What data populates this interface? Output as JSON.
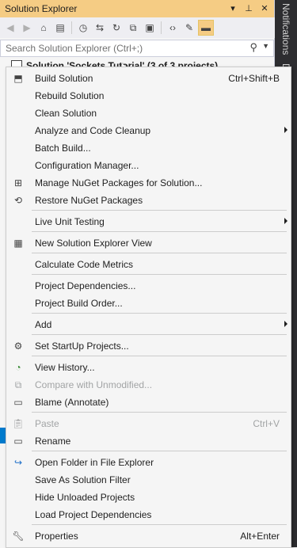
{
  "window": {
    "title": "Solution Explorer",
    "title_icons": [
      "chevron-down-icon",
      "pin-icon",
      "close-icon"
    ]
  },
  "toolbar": {
    "buttons": [
      "back-icon",
      "forward-icon",
      "home-icon",
      "switch-views-icon",
      "pending-changes-icon",
      "sync-icon",
      "refresh-icon",
      "collapse-all-icon",
      "show-all-files-icon",
      "view-code-icon",
      "properties-icon",
      "preview-icon"
    ]
  },
  "search": {
    "placeholder": "Search Solution Explorer (Ctrl+;)"
  },
  "tree": {
    "solution_label": "Solution 'Sockets Tutorial' (3 of 3 projects)"
  },
  "side_tabs": {
    "notifications": "Notifications",
    "second": "D"
  },
  "menu": {
    "items": [
      {
        "label": "Build Solution",
        "shortcut": "Ctrl+Shift+B",
        "icon": "build-icon"
      },
      {
        "label": "Rebuild Solution"
      },
      {
        "label": "Clean Solution"
      },
      {
        "label": "Analyze and Code Cleanup",
        "submenu": true
      },
      {
        "label": "Batch Build..."
      },
      {
        "label": "Configuration Manager..."
      },
      {
        "label": "Manage NuGet Packages for Solution...",
        "icon": "nuget-icon"
      },
      {
        "label": "Restore NuGet Packages",
        "icon": "restore-icon"
      },
      {
        "label": "Live Unit Testing",
        "submenu": true
      },
      {
        "label": "New Solution Explorer View",
        "icon": "new-view-icon"
      },
      {
        "label": "Calculate Code Metrics"
      },
      {
        "label": "Project Dependencies..."
      },
      {
        "label": "Project Build Order..."
      },
      {
        "label": "Add",
        "submenu": true
      },
      {
        "label": "Set StartUp Projects...",
        "icon": "gear-icon"
      },
      {
        "label": "View History...",
        "icon": "history-icon"
      },
      {
        "label": "Compare with Unmodified...",
        "icon": "compare-icon",
        "disabled": true
      },
      {
        "label": "Blame (Annotate)",
        "icon": "comment-icon"
      },
      {
        "label": "Paste",
        "shortcut": "Ctrl+V",
        "icon": "paste-icon",
        "disabled": true
      },
      {
        "label": "Rename",
        "icon": "rename-icon"
      },
      {
        "label": "Open Folder in File Explorer",
        "icon": "open-folder-icon"
      },
      {
        "label": "Save As Solution Filter"
      },
      {
        "label": "Hide Unloaded Projects"
      },
      {
        "label": "Load Project Dependencies"
      },
      {
        "label": "Properties",
        "shortcut": "Alt+Enter",
        "icon": "wrench-icon"
      }
    ]
  }
}
